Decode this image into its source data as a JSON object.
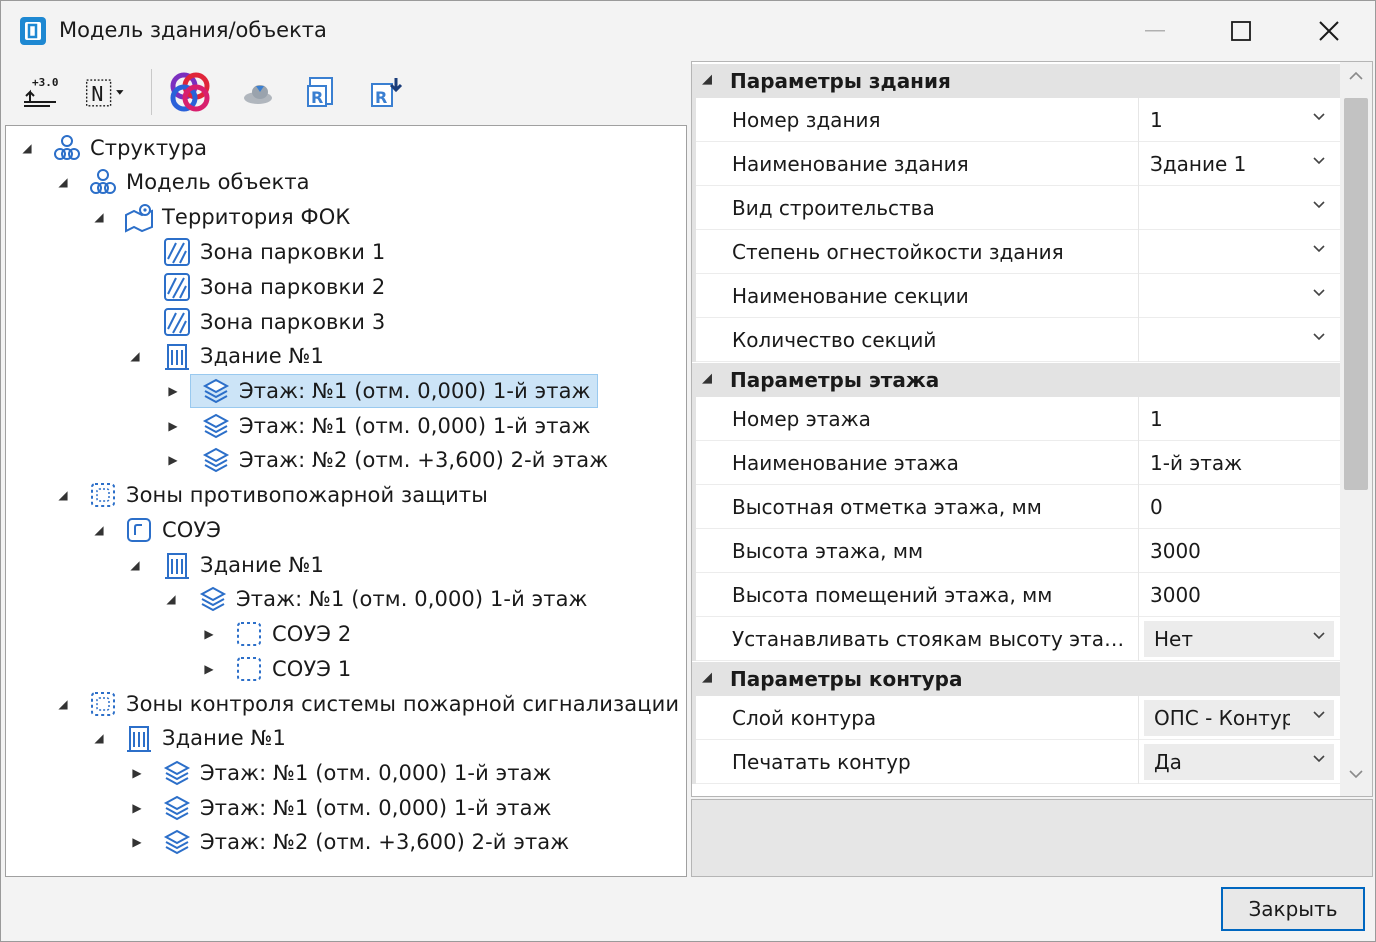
{
  "window": {
    "title": "Модель здания/объекта",
    "accent": "#0067c0"
  },
  "toolbar": {
    "buttons": [
      "level-mark-icon",
      "north-arrow-icon",
      "revit-model-icon",
      "cloud-icon",
      "revit-import-icon",
      "revit-export-icon"
    ],
    "level_text": "+3.0",
    "north_text": "N"
  },
  "tree": {
    "n0": "Структура",
    "n1": "Модель объекта",
    "n2": "Территория ФОК",
    "n3": "Зона парковки 1",
    "n4": "Зона парковки 2",
    "n5": "Зона парковки 3",
    "n6": "Здание №1",
    "n7": "Этаж: №1 (отм. 0,000) 1-й этаж",
    "n8": "Этаж: №1 (отм. 0,000) 1-й этаж",
    "n9": "Этаж: №2 (отм. +3,600) 2-й этаж",
    "n10": "Зоны противопожарной защиты",
    "n11": "СОУЭ",
    "n12": "Здание №1",
    "n13": "Этаж: №1 (отм. 0,000) 1-й этаж",
    "n14": "СОУЭ 2",
    "n15": "СОУЭ 1",
    "n16": "Зоны контроля системы пожарной сигнализации",
    "n17": "Здание №1",
    "n18": "Этаж: №1 (отм. 0,000) 1-й этаж",
    "n19": "Этаж: №1 (отм. 0,000) 1-й этаж",
    "n20": "Этаж: №2 (отм. +3,600) 2-й этаж"
  },
  "properties": {
    "cat_building": "Параметры здания",
    "building_number": {
      "name": "Номер здания",
      "value": "1"
    },
    "building_name": {
      "name": "Наименование здания",
      "value": "Здание 1"
    },
    "construction_type": {
      "name": "Вид строительства",
      "value": ""
    },
    "fire_resistance": {
      "name": "Степень огнестойкости здания",
      "value": ""
    },
    "section_name": {
      "name": "Наименование секции",
      "value": ""
    },
    "section_count": {
      "name": "Количество секций",
      "value": ""
    },
    "cat_floor": "Параметры этажа",
    "floor_number": {
      "name": "Номер этажа",
      "value": "1"
    },
    "floor_name": {
      "name": "Наименование этажа",
      "value": "1-й этаж"
    },
    "floor_elevation": {
      "name": "Высотная отметка этажа, мм",
      "value": "0"
    },
    "floor_height": {
      "name": "Высота этажа, мм",
      "value": "3000"
    },
    "rooms_height": {
      "name": "Высота помещений этажа, мм",
      "value": "3000"
    },
    "risers_height": {
      "name": "Устанавливать стоякам высоту этаж...",
      "value": "Нет"
    },
    "cat_contour": "Параметры контура",
    "contour_layer": {
      "name": "Слой контура",
      "value": "ОПС - Контур"
    },
    "print_contour": {
      "name": "Печатать контур",
      "value": "Да"
    }
  },
  "footer": {
    "close_label": "Закрыть"
  }
}
